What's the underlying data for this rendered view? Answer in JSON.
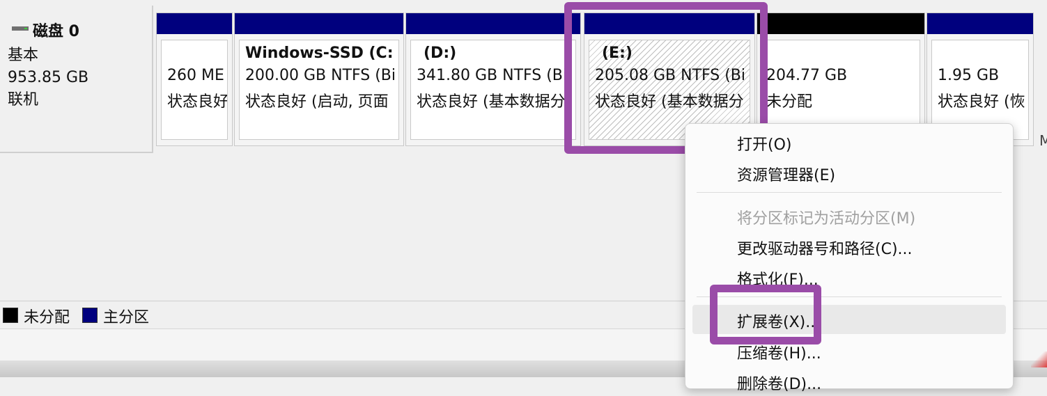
{
  "disk": {
    "name": "磁盘 0",
    "type": "基本",
    "size": "953.85 GB",
    "status": "联机"
  },
  "partitions": [
    {
      "title": "",
      "line1": "260 ME",
      "line2": "状态良好"
    },
    {
      "title": "Windows-SSD (C:",
      "line1": "200.00 GB NTFS (Bi",
      "line2": "状态良好 (启动, 页面"
    },
    {
      "title": "(D:)",
      "line1": "341.80 GB NTFS (Bi",
      "line2": "状态良好 (基本数据分"
    },
    {
      "title": "(E:)",
      "line1": "205.08 GB NTFS (Bi",
      "line2": "状态良好 (基本数据分"
    },
    {
      "title": "",
      "line1": "204.77 GB",
      "line2": "未分配"
    },
    {
      "title": "",
      "line1": "1.95 GB",
      "line2": "状态良好 (恢"
    }
  ],
  "legend": {
    "unallocated": "未分配",
    "primary": "主分区",
    "unallocated_color": "#000000",
    "primary_color": "#00007e"
  },
  "context_menu": {
    "items": [
      {
        "label": "打开(O)",
        "enabled": true
      },
      {
        "label": "资源管理器(E)",
        "enabled": true
      },
      {
        "label": "将分区标记为活动分区(M)",
        "enabled": false
      },
      {
        "label": "更改驱动器号和路径(C)...",
        "enabled": true
      },
      {
        "label": "格式化(F)...",
        "enabled": true
      },
      {
        "label": "扩展卷(X)...",
        "enabled": true
      },
      {
        "label": "压缩卷(H)...",
        "enabled": true
      },
      {
        "label": "删除卷(D)...",
        "enabled": true
      }
    ]
  },
  "highlight_color": "#9a4ca8"
}
